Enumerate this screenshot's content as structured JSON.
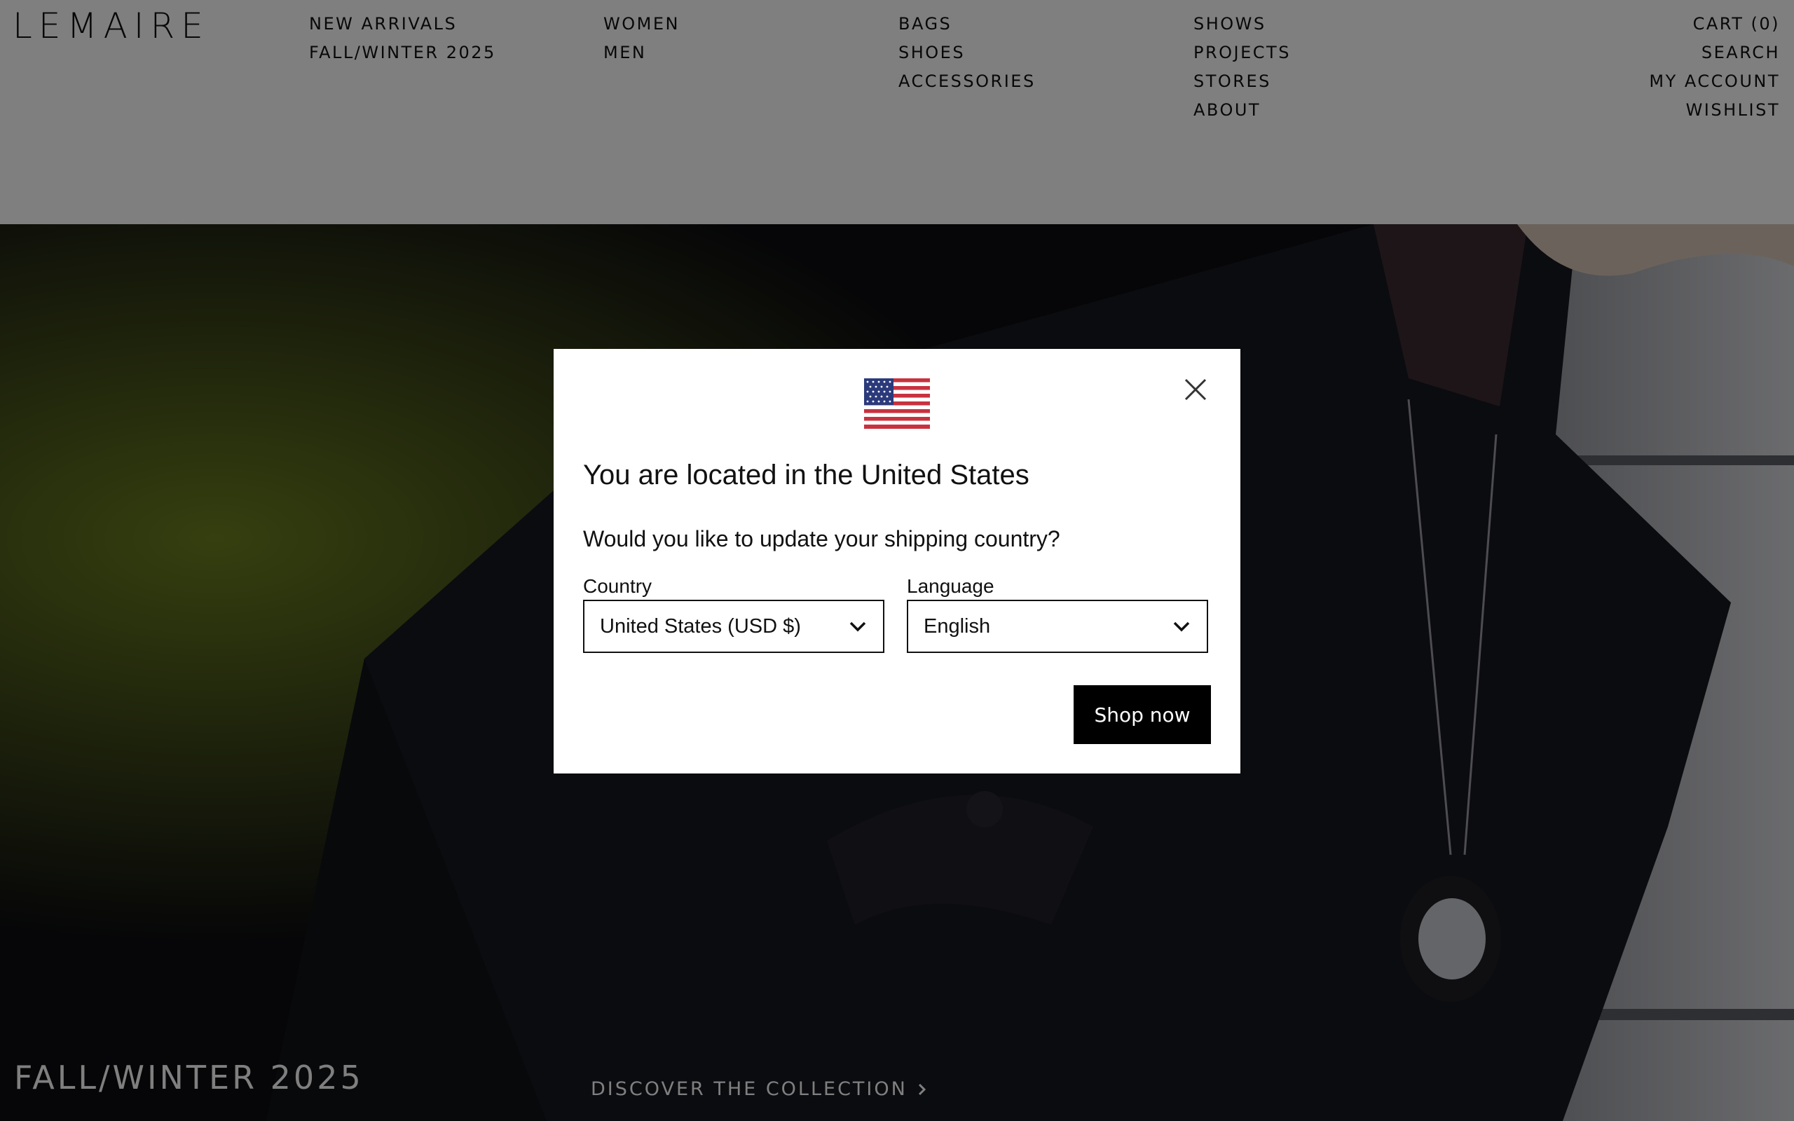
{
  "brand": {
    "logo": "LEMAIRE"
  },
  "nav": {
    "col1": [
      "NEW ARRIVALS",
      "FALL/WINTER 2025"
    ],
    "col2": [
      "WOMEN",
      "MEN"
    ],
    "col3": [
      "BAGS",
      "SHOES",
      "ACCESSORIES"
    ],
    "col4": [
      "SHOWS",
      "PROJECTS",
      "STORES",
      "ABOUT"
    ],
    "col5": [
      "CART (0)",
      "SEARCH",
      "MY ACCOUNT",
      "WISHLIST"
    ]
  },
  "hero": {
    "title": "FALL/WINTER 2025",
    "cta": "DISCOVER THE COLLECTION"
  },
  "modal": {
    "flag_icon": "us-flag-icon",
    "title": "You are located in the United States",
    "question": "Would you like to update your shipping country?",
    "country_label": "Country",
    "country_value": "United States (USD $)",
    "language_label": "Language",
    "language_value": "English",
    "shop_button": "Shop now"
  },
  "colors": {
    "overlay": "rgba(0,0,0,0.5)",
    "button_bg": "#000000",
    "text": "#111111"
  }
}
